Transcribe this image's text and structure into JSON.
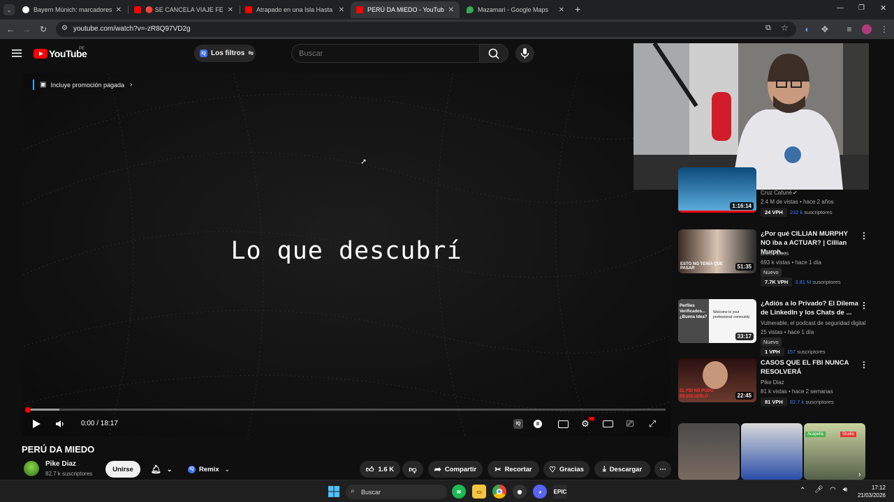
{
  "browser": {
    "tabs": [
      {
        "title": "Bayern Múnich: marcadores en",
        "active": false
      },
      {
        "title": "🔴 SE CANCELA VIAJE FEKA? 🔴",
        "active": false
      },
      {
        "title": "Atrapado en una Isla Hasta que",
        "active": false
      },
      {
        "title": "PERÚ DA MIEDO - YouTube",
        "active": true
      },
      {
        "title": "Mazamari - Google Maps",
        "active": false
      }
    ],
    "new_tab": "+",
    "url": "youtube.com/watch?v=-zR8Q97VD2g"
  },
  "youtube": {
    "logo_text": "YouTube",
    "country": "PE",
    "filters_label": "Los filtros",
    "search_placeholder": "Buscar"
  },
  "video": {
    "promo_label": "Incluye promoción pagada",
    "caption": "Lo que descubrí",
    "time": "0:00 / 18:17",
    "progress": 0.0,
    "buffer": 0.05,
    "title": "PERÚ DA MIEDO",
    "channel": "Pike Diaz",
    "subscribers": "82.7 k suscriptores",
    "join_label": "Unirse",
    "remix_label": "Remix",
    "likes": "1.6 K",
    "share_label": "Compartir",
    "clip_label": "Recortar",
    "thanks_label": "Gracias",
    "download_label": "Descargar"
  },
  "related": [
    {
      "title": "",
      "channel": "Cruz Cafuné",
      "stats": "2.4 M de vistas • hace 2 años",
      "duration": "1:16:14",
      "vph": "24 VPH",
      "subs": "232 k",
      "subs_suffix": "suscriptores",
      "nuevo": ""
    },
    {
      "title": "¿Por qué CILLIAN MURPHY NO iba a ACTUAR? | Cillian Murph...",
      "channel": "Dieck Docs",
      "stats": "693 k vistas • hace 1 día",
      "duration": "51:35",
      "vph": "7.7K VPH",
      "subs": "3.81 M",
      "subs_suffix": "suscriptores",
      "nuevo": "Nuevo",
      "thumb_text": "ESTO NO TENÍA QUE PASAR"
    },
    {
      "title": "¿Adiós a lo Privado? El Dilema de LinkedIn y los Chats de ...",
      "channel": "Vulnerable, el podcast de seguridad digital",
      "stats": "25 vistas • hace 1 día",
      "duration": "33:17",
      "vph": "1 VPH",
      "subs": "157",
      "subs_suffix": "suscriptores",
      "nuevo": "Nuevo",
      "thumb_text": "Perfiles Verificados... ¿Buena Idea?",
      "thumb_text2": "Welcome to your professional community"
    },
    {
      "title": "CASOS QUE EL FBI NUNCA RESOLVERÁ",
      "channel": "Pike Diaz",
      "stats": "81 k vistas • hace 2 semanas",
      "duration": "22:45",
      "vph": "81 VPH",
      "subs": "82.7 k",
      "subs_suffix": "suscriptores",
      "nuevo": "",
      "thumb_text": "EL FBI NO PUDO RESOLVERLO"
    }
  ],
  "shorts_labels": [
    "Acapella",
    "Studio"
  ],
  "taskbar": {
    "search": "Buscar",
    "time": "17:12",
    "date": "21/03/2026"
  },
  "colors": {
    "accent_red": "#ff0000",
    "link_blue": "#3e7bff",
    "bg": "#0f0f0f"
  }
}
